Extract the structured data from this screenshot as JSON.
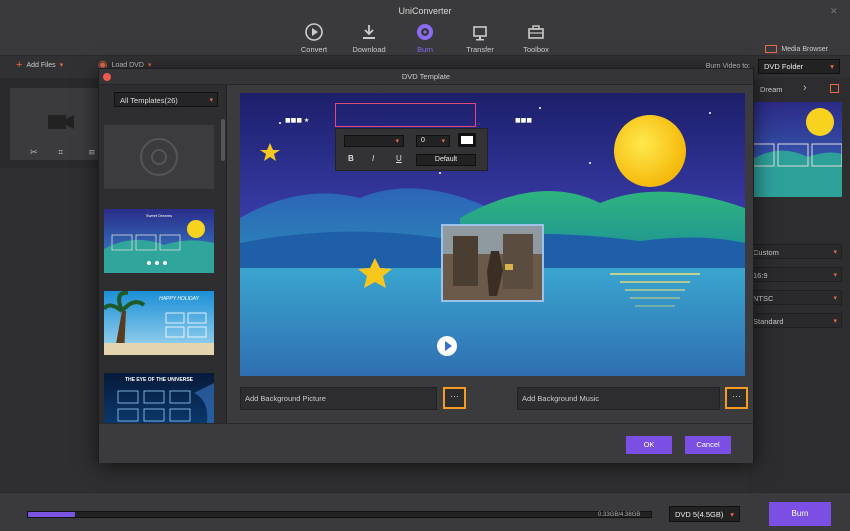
{
  "app": {
    "title": "UniConverter"
  },
  "toolbar": {
    "items": [
      {
        "label": "Convert",
        "icon": "convert-icon"
      },
      {
        "label": "Download",
        "icon": "download-icon"
      },
      {
        "label": "Burn",
        "icon": "burn-disc-icon",
        "active": true
      },
      {
        "label": "Transfer",
        "icon": "transfer-icon"
      },
      {
        "label": "Toolbox",
        "icon": "toolbox-icon"
      }
    ],
    "media_browser": "Media Browser"
  },
  "subbar": {
    "add_files": "Add Files",
    "load_dvd": "Load DVD",
    "burn_video_to_label": "Burn Video to:",
    "burn_video_to_value": "DVD Folder"
  },
  "right_panel": {
    "template_name": "Dream",
    "menu_type": "Custom",
    "aspect_ratio": "16:9",
    "tv_standard": "NTSC",
    "quality": "Standard"
  },
  "modal": {
    "title": "DVD Template",
    "template_filter": "All Templates(26)",
    "templates": [
      {
        "name": "no-template"
      },
      {
        "name": "dream-template",
        "title": "Sweet Dreams"
      },
      {
        "name": "holiday-template",
        "title": "HAPPY HOLIDAY"
      },
      {
        "name": "universe-template",
        "title": "THE EYE OF THE UNIVERSE"
      }
    ],
    "text_toolbar": {
      "font_size": "0",
      "bold": "B",
      "italic": "I",
      "underline": "U",
      "default_label": "Default"
    },
    "add_background_picture": "Add Background Picture",
    "add_background_music": "Add Background Music",
    "browse_label": "···",
    "ok": "OK",
    "cancel": "Cancel"
  },
  "bottombar": {
    "size_used": "0.33GB/4.38GB",
    "progress": 0.075,
    "disc_type": "DVD 5(4.5GB)",
    "burn": "Burn"
  },
  "colors": {
    "accent": "#7b4fe3",
    "highlight": "#f39b23",
    "warn": "#e86a4a"
  }
}
